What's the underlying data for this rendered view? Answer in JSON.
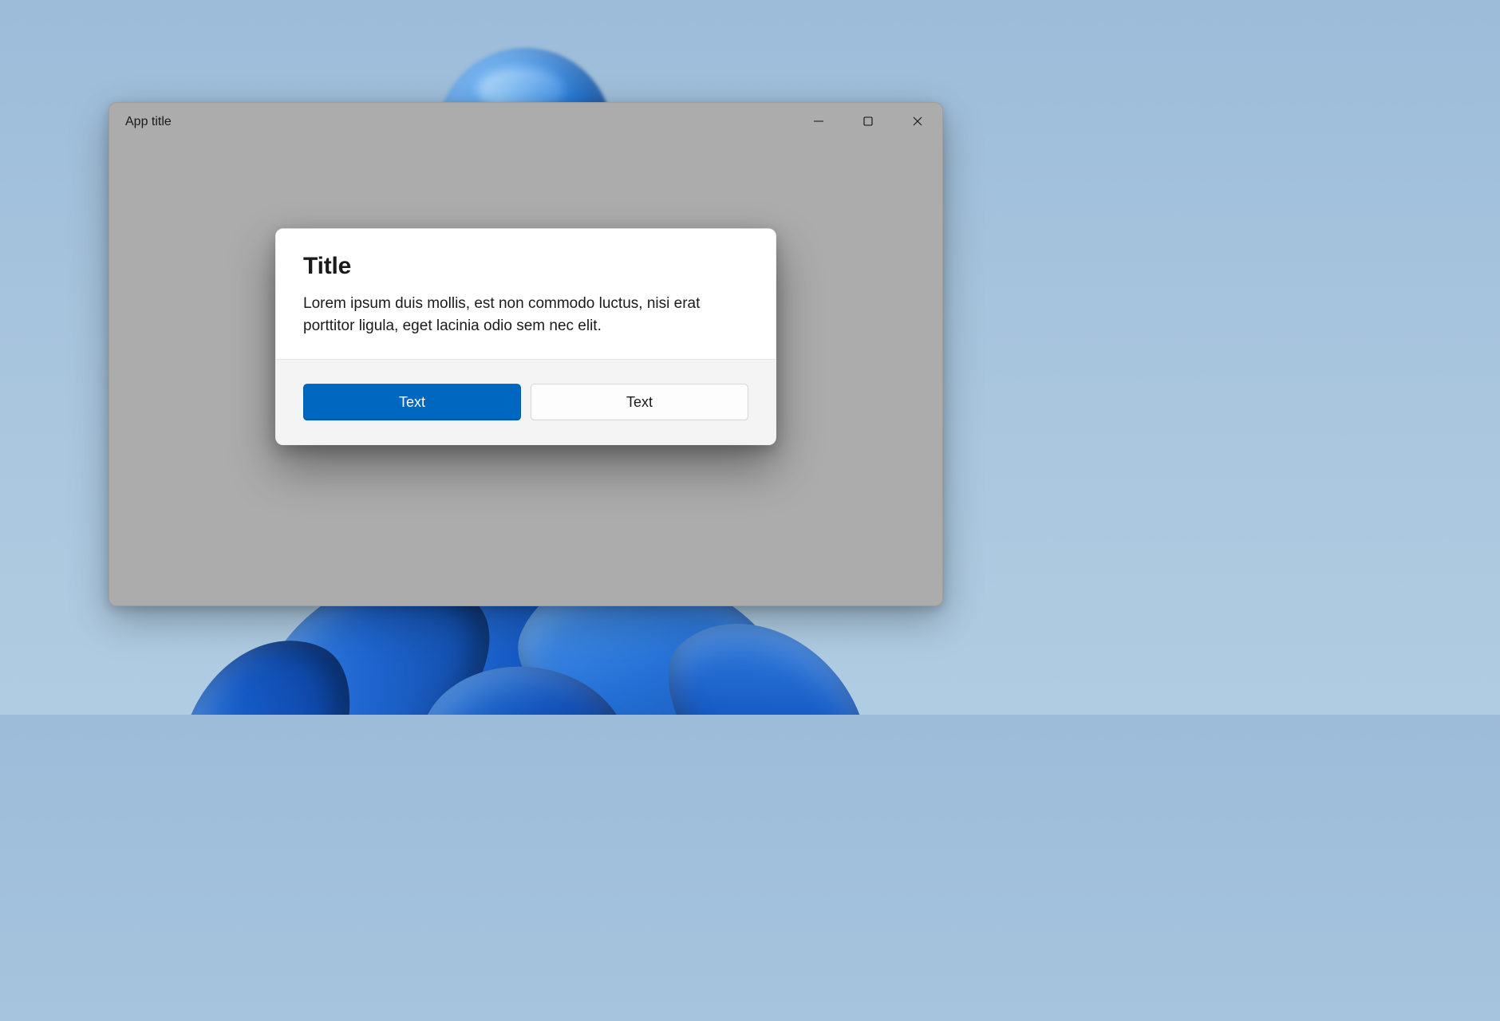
{
  "window": {
    "app_title": "App title"
  },
  "dialog": {
    "title": "Title",
    "body": "Lorem ipsum duis mollis, est non commodo luctus, nisi erat porttitor ligula, eget lacinia odio sem nec elit.",
    "primary_button_label": "Text",
    "secondary_button_label": "Text"
  },
  "colors": {
    "accent": "#0067c0",
    "window_dim": "#acacac",
    "dialog_bg": "#ffffff",
    "dialog_footer_bg": "#f4f4f4"
  }
}
